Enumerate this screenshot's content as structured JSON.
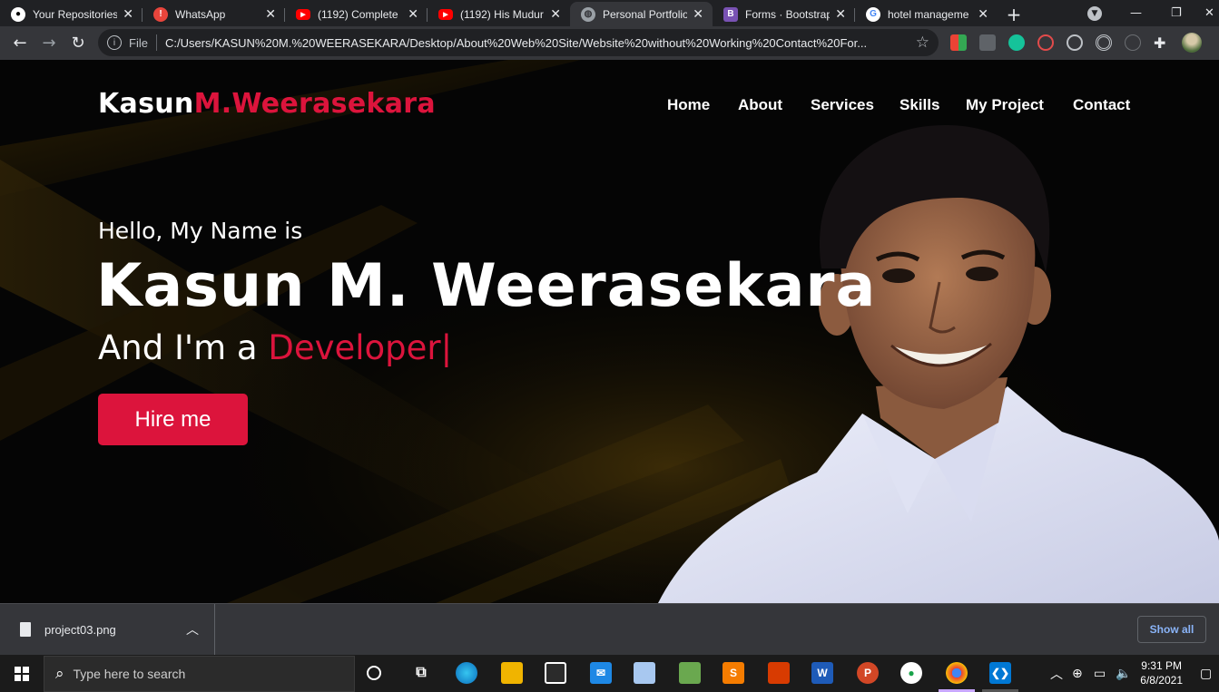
{
  "browser": {
    "tabs": [
      {
        "title": "Your Repositories",
        "icon": "github-icon",
        "color": "#ffffff"
      },
      {
        "title": "WhatsApp",
        "icon": "whatsapp-icon",
        "color": "#e8453c"
      },
      {
        "title": "(1192) Complete",
        "icon": "youtube-icon",
        "color": "#ff0000"
      },
      {
        "title": "(1192) His Mudur",
        "icon": "youtube-icon",
        "color": "#ff0000"
      },
      {
        "title": "Personal Portfolio",
        "icon": "globe-icon",
        "color": "#9aa0a6",
        "active": true
      },
      {
        "title": "Forms · Bootstrap",
        "icon": "bootstrap-icon",
        "color": "#7952b3",
        "letter": "B"
      },
      {
        "title": "hotel manageme",
        "icon": "google-icon",
        "color": "#ffffff",
        "letter": "G"
      }
    ],
    "new_tab": "+",
    "address": {
      "scheme_label": "File",
      "url": "C:/Users/KASUN%20M.%20WEERASEKARA/Desktop/About%20Web%20Site/Website%20without%20Working%20Contact%20For..."
    }
  },
  "site": {
    "logo_first": "Kasun",
    "logo_second": "M.Weerasekara",
    "nav": [
      "Home",
      "About",
      "Services",
      "Skills",
      "My Project",
      "Contact"
    ],
    "hello": "Hello, My Name is",
    "name": "Kasun M. Weerasekara",
    "role_prefix": "And I'm a ",
    "role_typed": "Developer",
    "role_cursor": "|",
    "cta": "Hire me",
    "accent": "#dc143c"
  },
  "downloads": {
    "file": "project03.png",
    "show_all": "Show all"
  },
  "taskbar": {
    "search_placeholder": "Type here to search",
    "time": "9:31 PM",
    "date": "6/8/2021"
  }
}
